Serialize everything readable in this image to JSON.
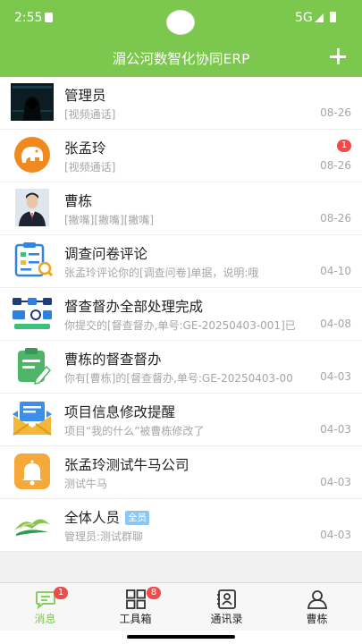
{
  "statusbar": {
    "time": "2:55",
    "network": "5G"
  },
  "header": {
    "title": "湄公河数智化协同ERP",
    "add_icon": "plus-icon"
  },
  "colors": {
    "brand": "#7cc84e",
    "badge": "#f04a4a",
    "tag": "#8cc6f2"
  },
  "messages": [
    {
      "name": "管理员",
      "preview": "[视频通话]",
      "date": "08-26",
      "icon": "hacker-photo-avatar"
    },
    {
      "name": "张孟玲",
      "preview": "[视频通话]",
      "date": "08-26",
      "unread": "1",
      "icon": "elephant-avatar"
    },
    {
      "name": "曹栋",
      "preview": "[撇嘴][撇嘴][撇嘴]",
      "date": "08-26",
      "icon": "person-photo-avatar"
    },
    {
      "name": "调查问卷评论",
      "preview": "张孟玲评论你的[调查问卷]单据，说明:哦",
      "date": "04-10",
      "icon": "survey-icon"
    },
    {
      "name": "督查督办全部处理完成",
      "preview": "你提交的[督查督办,单号:GE-20250403-001]已",
      "date": "04-08",
      "icon": "workflow-icon"
    },
    {
      "name": "曹栋的督查督办",
      "preview": "你有[曹栋]的[督查督办,单号:GE-20250403-00",
      "date": "04-03",
      "icon": "clipboard-edit-icon"
    },
    {
      "name": "项目信息修改提醒",
      "preview": "项目“我的什么”被曹栋修改了",
      "date": "04-03",
      "icon": "envelope-icon"
    },
    {
      "name": "张孟玲测试牛马公司",
      "preview": "测试牛马",
      "date": "04-03",
      "icon": "bell-icon"
    },
    {
      "name": "全体人员",
      "tag": "全员",
      "preview": "管理员:测试群聊",
      "date": "04-03",
      "icon": "landscape-logo-icon"
    }
  ],
  "tabs": [
    {
      "label": "消息",
      "badge": "1",
      "icon": "chat-icon",
      "active": true
    },
    {
      "label": "工具箱",
      "badge": "8",
      "icon": "grid-icon"
    },
    {
      "label": "通讯录",
      "icon": "contacts-icon"
    },
    {
      "label": "曹栋",
      "icon": "user-icon"
    }
  ]
}
